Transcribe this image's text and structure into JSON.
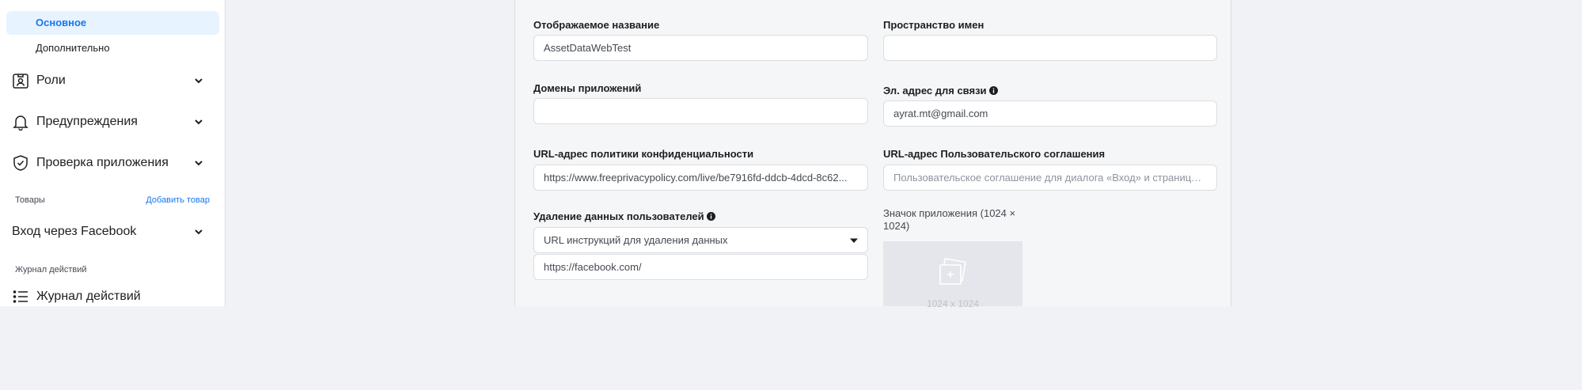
{
  "sidebar": {
    "sub_items": [
      {
        "label": "Основное",
        "active": true
      },
      {
        "label": "Дополнительно",
        "active": false
      }
    ],
    "items": [
      {
        "label": "Роли",
        "icon": "roles-badge-icon"
      },
      {
        "label": "Предупреждения",
        "icon": "bell-icon"
      },
      {
        "label": "Проверка приложения",
        "icon": "shield-check-icon"
      }
    ],
    "products_caption": "Товары",
    "add_product_link": "Добавить товар",
    "facebook_login": "Вход через Facebook",
    "activity_caption": "Журнал действий",
    "activity_item": {
      "label": "Журнал действий",
      "icon": "list-icon"
    }
  },
  "form": {
    "display_name": {
      "label": "Отображаемое название",
      "value": "AssetDataWebTest"
    },
    "namespace": {
      "label": "Пространство имен",
      "value": ""
    },
    "app_domains": {
      "label": "Домены приложений",
      "value": ""
    },
    "contact_email": {
      "label": "Эл. адрес для связи",
      "value": "ayrat.mt@gmail.com"
    },
    "privacy_url": {
      "label": "URL-адрес политики конфиденциальности",
      "value": "https://www.freeprivacypolicy.com/live/be7916fd-ddcb-4dcd-8c62..."
    },
    "tos_url": {
      "label": "URL-адрес Пользовательского соглашения",
      "placeholder": "Пользовательское соглашение для диалога «Вход» и страницы..."
    },
    "data_deletion": {
      "label": "Удаление данных пользователей",
      "selected_option": "URL инструкций для удаления данных",
      "value": "https://facebook.com/"
    },
    "app_icon": {
      "label": "Значок приложения (1024 × 1024)",
      "dims_text": "1024 x 1024"
    }
  },
  "colors": {
    "accent": "#1877f2",
    "active_bg": "#e7f3ff",
    "page_bg": "#f0f2f5",
    "card_bg": "#f5f6f7"
  }
}
